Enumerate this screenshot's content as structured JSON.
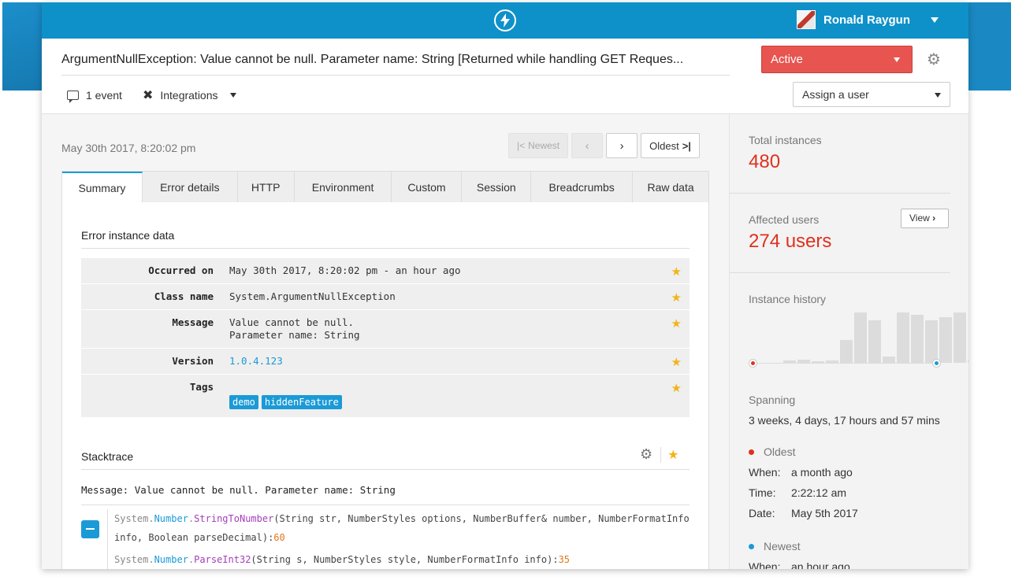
{
  "user": {
    "name": "Ronald Raygun"
  },
  "error": {
    "title": "ArgumentNullException: Value cannot be null. Parameter name: String [Returned while handling GET Reques..."
  },
  "status": {
    "label": "Active",
    "color": "#e85550"
  },
  "meta": {
    "events": "1 event",
    "integrations": "Integrations"
  },
  "assign": {
    "label": "Assign a user"
  },
  "instance": {
    "date": "May 30th 2017, 8:20:02 pm"
  },
  "pager": {
    "newest": "Newest",
    "oldest": "Oldest"
  },
  "tabs": [
    "Summary",
    "Error details",
    "HTTP",
    "Environment",
    "Custom",
    "Session",
    "Breadcrumbs",
    "Raw data"
  ],
  "instance_data": {
    "title": "Error instance data",
    "rows": [
      {
        "key": "Occurred on",
        "value": "May 30th 2017, 8:20:02 pm - an hour ago"
      },
      {
        "key": "Class name",
        "value": "System.ArgumentNullException"
      },
      {
        "key": "Message",
        "value": "Value cannot be null.\nParameter name: String"
      },
      {
        "key": "Version",
        "value": "1.0.4.123"
      },
      {
        "key": "Tags",
        "tags": [
          "demo",
          "hiddenFeature"
        ]
      }
    ]
  },
  "stacktrace": {
    "title": "Stacktrace",
    "message": "Message: Value cannot be null. Parameter name: String",
    "frames": [
      {
        "ns": "System.",
        "cls": "Number",
        "dot": ".",
        "fn": "StringToNumber",
        "args": "(String str, NumberStyles options, NumberBuffer& number, NumberFormatInfo info, Boolean parseDecimal):",
        "line": "60"
      },
      {
        "ns": "System.",
        "cls": "Number",
        "dot": ".",
        "fn": "ParseInt32",
        "args": "(String s, NumberStyles style, NumberFormatInfo info):",
        "line": "35"
      }
    ]
  },
  "sidebar": {
    "total_label": "Total instances",
    "total_value": "480",
    "affected_label": "Affected users",
    "affected_value": "274 users",
    "view_label": "View",
    "history_label": "Instance history",
    "history_values": [
      0,
      0,
      0.05,
      0.06,
      0.02,
      0.04,
      0.45,
      1.0,
      0.85,
      0.12,
      1.0,
      0.95,
      0.85,
      0.9,
      1.0,
      0.06,
      0
    ],
    "spanning_label": "Spanning",
    "spanning_value": "3 weeks, 4 days, 17 hours and 57 mins",
    "oldest": {
      "label": "Oldest",
      "color": "#e0301e",
      "when_label": "When:",
      "when": "a month ago",
      "time_label": "Time:",
      "time": "2:22:12 am",
      "date_label": "Date:",
      "date": "May 5th 2017"
    },
    "newest": {
      "label": "Newest",
      "color": "#1a9ad6",
      "when_label": "When:",
      "when": "an hour ago"
    }
  }
}
